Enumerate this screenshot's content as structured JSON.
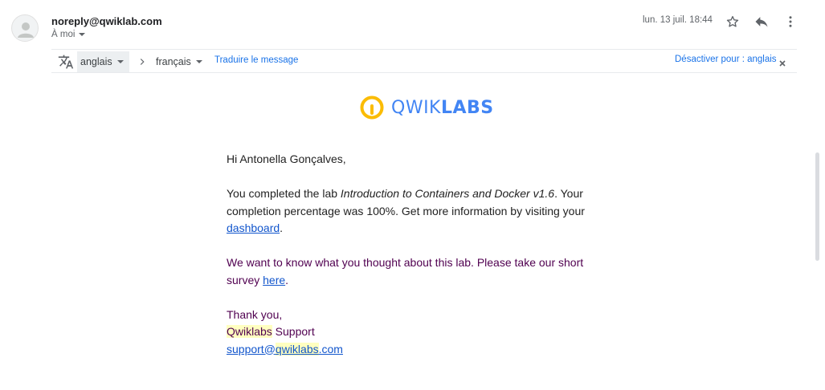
{
  "header": {
    "sender": "noreply@qwiklab.com",
    "recipient": "À moi",
    "date": "lun. 13 juil. 18:44",
    "icons": [
      "person-icon",
      "star-icon",
      "reply-icon",
      "more-vert-icon"
    ]
  },
  "translate_bar": {
    "source_lang": "anglais",
    "target_lang": "français",
    "translate_link": "Traduire le message",
    "disable_link": "Désactiver pour : anglais",
    "icons": [
      "translate-icon",
      "chevron-right-icon",
      "close-icon"
    ]
  },
  "logo": {
    "part1": "QWIK",
    "part2": "LABS",
    "accent": "#fbbc05",
    "brand": "#4285f4"
  },
  "message": {
    "greeting": "Hi Antonella Gonçalves,",
    "p1_pre": "You completed the lab ",
    "p1_lab": "Introduction to Containers and Docker v1.6",
    "p1_post": ". Your completion percentage was 100%. Get more information by visiting your ",
    "p1_link": "dashboard",
    "p1_end": ".",
    "p2_pre": "We want to know what you thought about this lab. Please take our short survey ",
    "p2_link": "here",
    "p2_end": ".",
    "thanks": "Thank you,",
    "sig_brand": "Qwiklabs",
    "sig_rest": " Support",
    "email_pre": "support@",
    "email_brand": "qwiklabs",
    "email_post": ".com"
  }
}
